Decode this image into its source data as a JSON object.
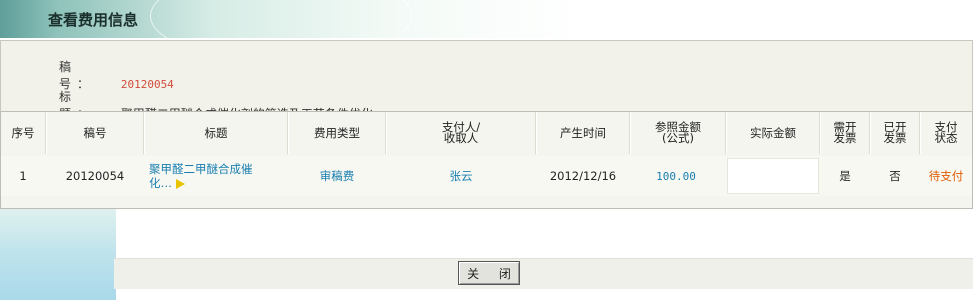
{
  "header": {
    "title": "查看费用信息"
  },
  "manuscript": {
    "no_label": "稿  号：",
    "no_value": "20120054",
    "title_label": "标  题：",
    "title_value": "聚甲醛二甲醚合成催化剂的筛选及工艺条件优化"
  },
  "table": {
    "columns": {
      "seq": "序号",
      "no": "稿号",
      "title": "标题",
      "fee_type": "费用类型",
      "payer_line1": "支付人/",
      "payer_line2": "收取人",
      "time": "产生时间",
      "ref_line1": "参照金额",
      "ref_line2": "(公式)",
      "actual": "实际金额",
      "need_line1": "需开",
      "need_line2": "发票",
      "issued_line1": "已开",
      "issued_line2": "发票",
      "pay_line1": "支付",
      "pay_line2": "状态"
    },
    "rows": [
      {
        "seq": "1",
        "no": "20120054",
        "title_line1": "聚甲醛二甲醚合成催",
        "title_line2": "化…",
        "fee_type": "审稿费",
        "payer": "张云",
        "time": "2012/12/16",
        "ref_amount": "100.00",
        "actual_amount": "",
        "need_invoice": "是",
        "issued_invoice": "否",
        "pay_status": "待支付"
      }
    ]
  },
  "footer": {
    "close_label": "关 闭"
  },
  "colors": {
    "link": "#1a7fb0",
    "status": "#e05a00",
    "manuscript_no": "#d24b3c"
  }
}
